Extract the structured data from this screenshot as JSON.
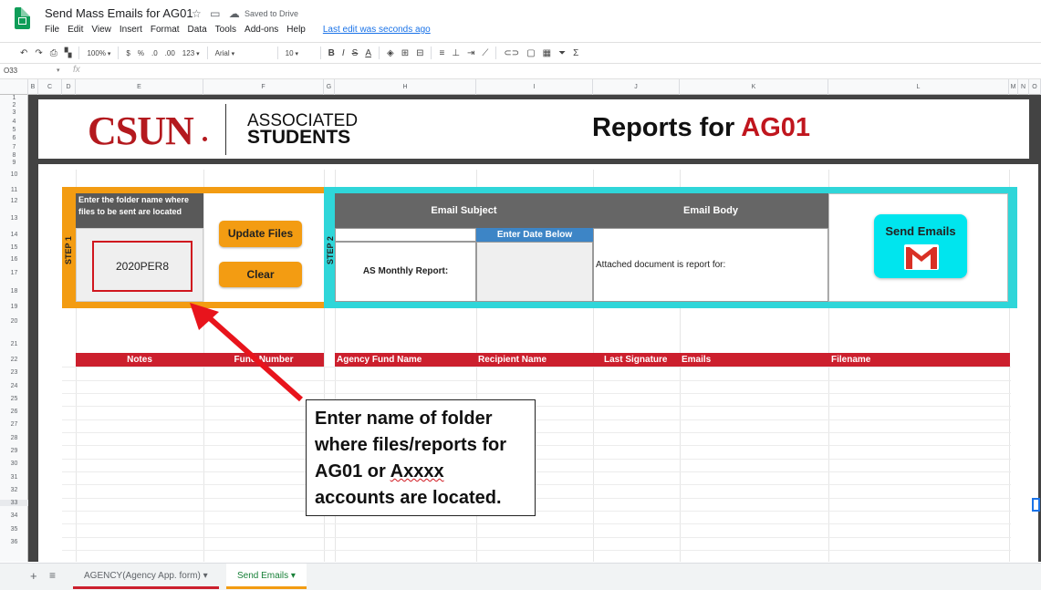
{
  "title_bar": {
    "doc_title": "Send Mass Emails for AG01",
    "saved_status": "Saved to Drive",
    "last_edit": "Last edit was seconds ago"
  },
  "menu": [
    "File",
    "Edit",
    "View",
    "Insert",
    "Format",
    "Data",
    "Tools",
    "Add-ons",
    "Help"
  ],
  "toolbar": {
    "zoom": "100%",
    "currency": "$",
    "percent": "%",
    "dec_less": ".0",
    "dec_more": ".00",
    "more_formats": "123",
    "font": "Arial",
    "font_size": "10",
    "bold": "B",
    "italic": "I",
    "strike": "S",
    "text_color": "A",
    "sigma": "Σ"
  },
  "formula_bar": {
    "name_box": "O33",
    "fx": "fx"
  },
  "columns": [
    "B",
    "C",
    "D",
    "E",
    "F",
    "G",
    "H",
    "I",
    "J",
    "K",
    "L",
    "M",
    "N",
    "O"
  ],
  "rows": [
    "1",
    "2",
    "3",
    "4",
    "5",
    "6",
    "7",
    "8",
    "9",
    "10",
    "11",
    "12",
    "13",
    "14",
    "15",
    "16",
    "17",
    "18",
    "19",
    "20",
    "21",
    "22",
    "23",
    "24",
    "25",
    "26",
    "27",
    "28",
    "29",
    "30",
    "31",
    "32",
    "33",
    "34",
    "35",
    "36"
  ],
  "banner": {
    "logo_csun": "CSUN",
    "logo_assoc_line1": "ASSOCIATED",
    "logo_assoc_line2": "STUDENTS",
    "heading_prefix": "Reports for ",
    "heading_code": "AG01"
  },
  "step1": {
    "label": "STEP 1",
    "folder_header": "Enter the folder name where files to be sent are located",
    "folder_value": "2020PER8",
    "update_button": "Update Files",
    "clear_button": "Clear"
  },
  "step2": {
    "label": "STEP 2",
    "email_subject_header": "Email Subject",
    "email_body_header": "Email Body",
    "date_header": "Enter Date Below",
    "subject_label": "AS Monthly Report:",
    "body_text": "Attached document is report for:",
    "send_button": "Send Emails"
  },
  "table_headers": [
    "Notes",
    "Fund Number",
    "Agency Fund Name",
    "Recipient Name",
    "Last Signature",
    "Emails",
    "Filename"
  ],
  "callout": {
    "line1": "Enter name of folder",
    "line2": "where files/reports for",
    "line3": "AG01 or ",
    "line3_underlined": "Axxxx",
    "line4": "accounts are located."
  },
  "sheet_tabs": [
    "AGENCY(Agency App. form)",
    "Send Emails"
  ],
  "colors": {
    "accent_red": "#cc1f2d",
    "step1_orange": "#f39c12",
    "step2_cyan": "#2fd6d9",
    "date_blue": "#3d85c6"
  }
}
